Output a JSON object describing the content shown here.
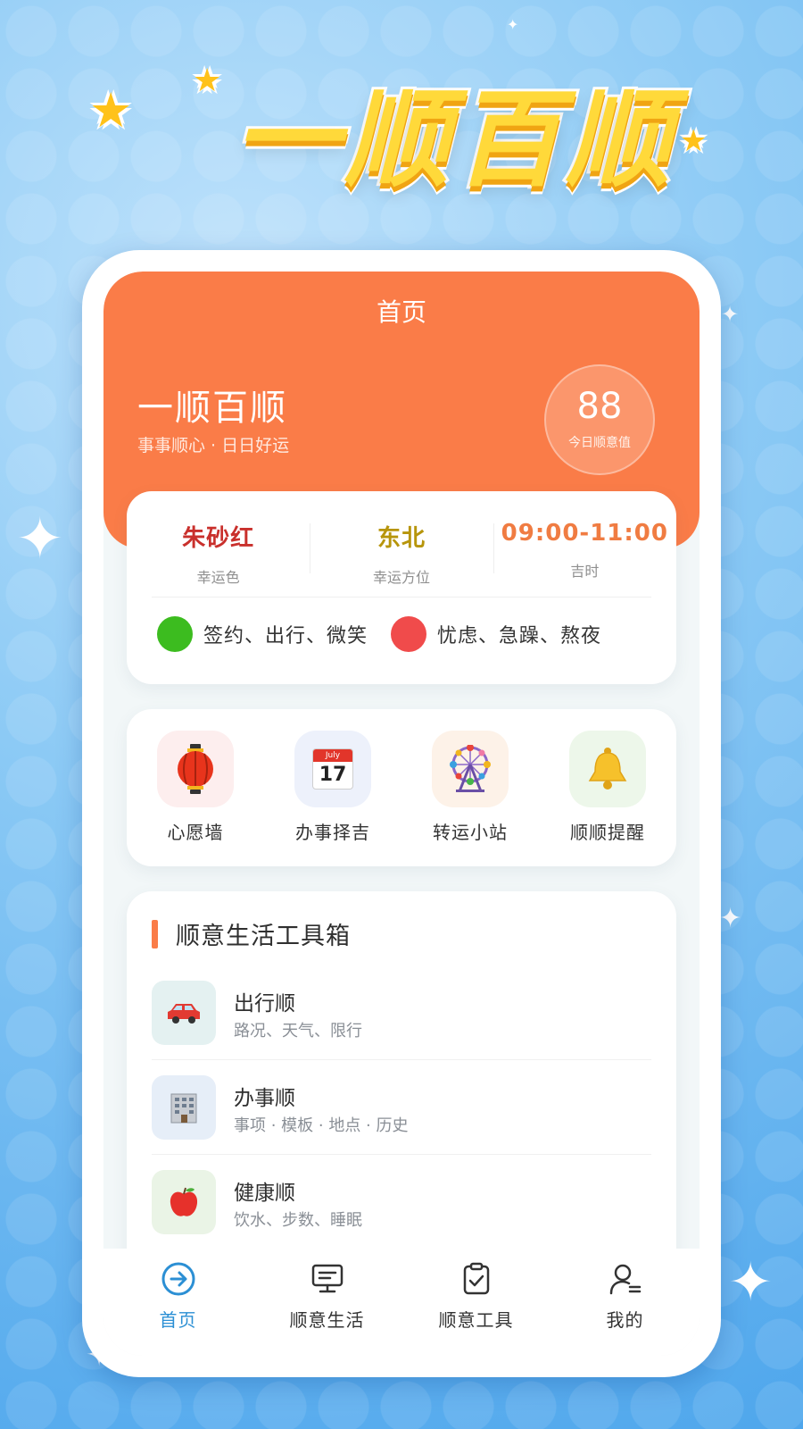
{
  "banner": {
    "title": "一顺百顺"
  },
  "header": {
    "nav_title": "首页",
    "title": "一顺百顺",
    "subtitle": "事事顺心 · 日日好运"
  },
  "score": {
    "value": "88",
    "label": "今日顺意值"
  },
  "luck": {
    "items": [
      {
        "value": "朱砂红",
        "label": "幸运色",
        "color": "#c9302c"
      },
      {
        "value": "东北",
        "label": "幸运方位",
        "color": "#b7950b"
      },
      {
        "value": "09:00-11:00",
        "label": "吉时",
        "color": "#f07c42"
      }
    ],
    "good": {
      "text": "签约、出行、微笑",
      "color": "#3cbc1f"
    },
    "bad": {
      "text": "忧虑、急躁、熬夜",
      "color": "#f04b4b"
    }
  },
  "quick": [
    {
      "label": "心愿墙",
      "icon": "lantern-icon",
      "bg": "#fdeeee"
    },
    {
      "label": "办事择吉",
      "icon": "calendar-icon",
      "calendar_month": "July",
      "calendar_day": "17",
      "bg": "#edf1fb"
    },
    {
      "label": "转运小站",
      "icon": "ferris-wheel-icon",
      "bg": "#fdf2e8"
    },
    {
      "label": "顺顺提醒",
      "icon": "bell-icon",
      "bg": "#edf7ea"
    }
  ],
  "toolbox": {
    "title": "顺意生活工具箱",
    "items": [
      {
        "name": "出行顺",
        "desc": "路况、天气、限行",
        "icon": "car-icon",
        "bg": "#e4f1f1"
      },
      {
        "name": "办事顺",
        "desc": "事项 · 模板 · 地点 · 历史",
        "icon": "office-building-icon",
        "bg": "#e6eef8"
      },
      {
        "name": "健康顺",
        "desc": "饮水、步数、睡眠",
        "icon": "apple-icon",
        "bg": "#eaf4e6"
      }
    ]
  },
  "tabs": [
    {
      "label": "首页",
      "icon": "home-arrow-icon",
      "active": true
    },
    {
      "label": "顺意生活",
      "icon": "monitor-icon",
      "active": false
    },
    {
      "label": "顺意工具",
      "icon": "clipboard-check-icon",
      "active": false
    },
    {
      "label": "我的",
      "icon": "user-icon",
      "active": false
    }
  ],
  "colors": {
    "accent": "#fa7c48",
    "tab_active": "#2b8fd4"
  }
}
